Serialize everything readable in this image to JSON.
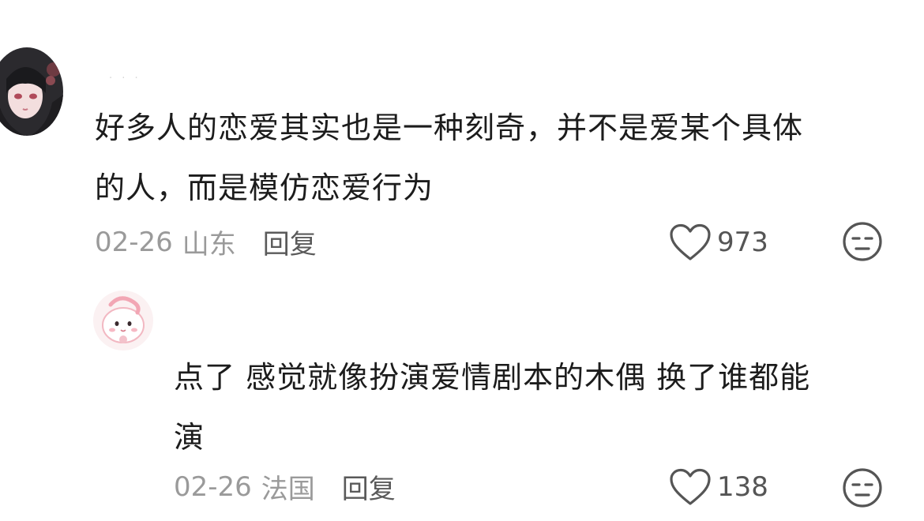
{
  "comments": [
    {
      "avatar_icon": "anime-girl-avatar",
      "username": "· ·   ·",
      "text_line1": "好多人的恋爱其实也是一种刻奇，并不是爱某个具体",
      "text_line2": "的人，而是模仿恋爱行为",
      "date": "02-26",
      "location": "山东",
      "reply_label": "回复",
      "like_count": "973",
      "like_icon": "heart-outline-icon",
      "dislike_icon": "unamused-face-icon"
    },
    {
      "avatar_icon": "pink-bunny-avatar",
      "text_line1": "点了 感觉就像扮演爱情剧本的木偶 换了谁都能",
      "text_line2": "演",
      "date": "02-26",
      "location": "法国",
      "reply_label": "回复",
      "like_count": "138",
      "like_icon": "heart-outline-icon",
      "dislike_icon": "unamused-face-icon"
    }
  ],
  "colors": {
    "text_primary": "#1c1c1c",
    "text_meta": "#9a9a9a",
    "text_reply": "#5a5a5a",
    "icon_gray": "#555555"
  }
}
